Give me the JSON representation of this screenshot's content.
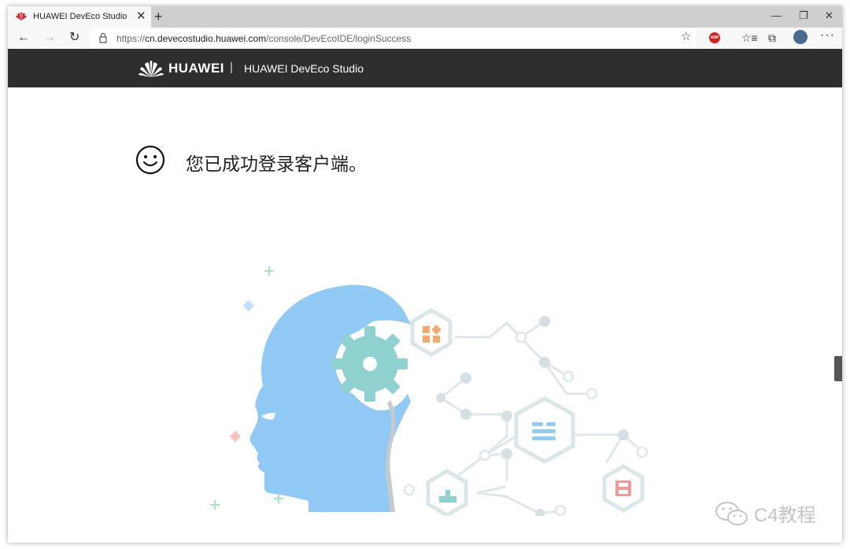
{
  "browser": {
    "tab_title": "HUAWEI DevEco Studio",
    "tab_close": "✕",
    "new_tab": "+",
    "window_controls": {
      "minimize": "—",
      "restore": "❐",
      "close": "✕"
    },
    "nav": {
      "back": "←",
      "forward": "→",
      "refresh": "↻"
    },
    "url_prefix": "https://",
    "url_host": "cn.devecostudio.huawei.com",
    "url_path": "/console/DevEcoIDE/loginSuccess",
    "favorite": "☆",
    "abp_label": "ABP",
    "reading_list": "☆≡",
    "collections": "⧉",
    "more": "···"
  },
  "header": {
    "brand": "HUAWEI",
    "separator": "|",
    "product": "HUAWEI DevEco Studio"
  },
  "main": {
    "success_message": "您已成功登录客户端。"
  },
  "watermark": {
    "text": "C4教程"
  },
  "colors": {
    "header_bg": "#2e2e2e",
    "head_blue": "#91c9f5",
    "gear_teal": "#8fd1cf",
    "hex_border": "#dbe6e8",
    "node_gray": "#d6dfe2",
    "huawei_red": "#cf1f2a"
  }
}
